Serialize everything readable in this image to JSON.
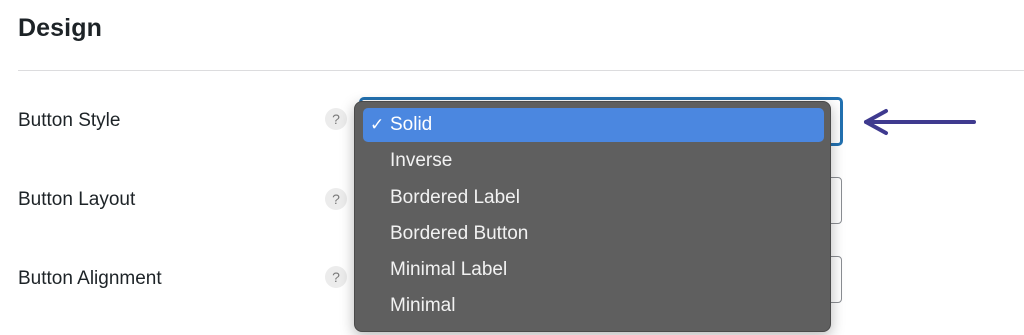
{
  "section": {
    "title": "Design"
  },
  "rows": [
    {
      "label": "Button Style"
    },
    {
      "label": "Button Layout"
    },
    {
      "label": "Button Alignment"
    }
  ],
  "help_symbol": "?",
  "dropdown": {
    "check_mark": "✓",
    "options": [
      {
        "label": "Solid",
        "selected": true
      },
      {
        "label": "Inverse",
        "selected": false
      },
      {
        "label": "Bordered Label",
        "selected": false
      },
      {
        "label": "Bordered Button",
        "selected": false
      },
      {
        "label": "Minimal Label",
        "selected": false
      },
      {
        "label": "Minimal",
        "selected": false
      }
    ]
  },
  "colors": {
    "accent": "#2271b1",
    "dropdown_bg": "#5f5f5f",
    "selected_option": "#4b87e0",
    "annotation_arrow": "#3f3a8f"
  },
  "annotation": {
    "icon": "left-arrow-icon"
  }
}
